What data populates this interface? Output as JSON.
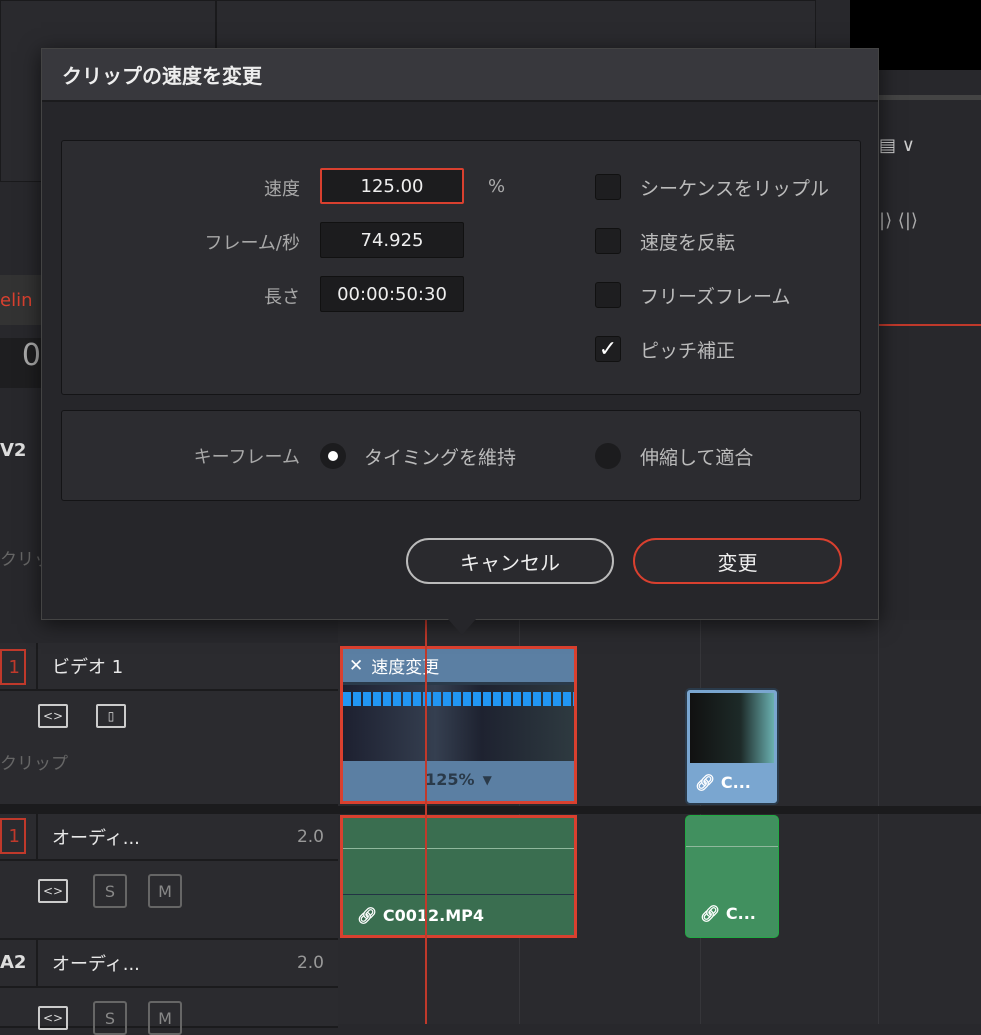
{
  "dialog": {
    "title": "クリップの速度を変更",
    "fields": [
      {
        "label": "速度",
        "value": "125.00",
        "unit": "%"
      },
      {
        "label": "フレーム/秒",
        "value": "74.925"
      },
      {
        "label": "長さ",
        "value": "00:00:50:30"
      }
    ],
    "checkboxes": [
      {
        "label": "シーケンスをリップル",
        "checked": false
      },
      {
        "label": "速度を反転",
        "checked": false
      },
      {
        "label": "フリーズフレーム",
        "checked": false
      },
      {
        "label": "ピッチ補正",
        "checked": true
      }
    ],
    "keyframe": {
      "label": "キーフレーム",
      "options": [
        {
          "label": "タイミングを維持",
          "selected": true
        },
        {
          "label": "伸縮して適合",
          "selected": false
        }
      ]
    },
    "cancel": "キャンセル",
    "change": "変更",
    "check_mark": "✓"
  },
  "background": {
    "tab_partial": "elin",
    "timecode_partial": "0",
    "v2_label": "V2",
    "clip_hint_1": "クリップ",
    "clip_hint_2": "クリップ"
  },
  "tracks": [
    {
      "num": "1",
      "name": "ビデオ 1"
    },
    {
      "num": "1",
      "name": "オーディ...",
      "channels": "2.0",
      "solo": "S",
      "mute": "M"
    },
    {
      "num": "A2",
      "name": "オーディ...",
      "channels": "2.0",
      "solo": "S",
      "mute": "M"
    }
  ],
  "clips": {
    "video_main": {
      "title": "速度変更",
      "speed": "125%"
    },
    "video_second": {
      "name": "C..."
    },
    "audio_main": {
      "name": "C0012.MP4"
    },
    "audio_second": {
      "name": "C..."
    }
  },
  "colors": {
    "accent": "#d9402f",
    "video_clip": "#5b7fa3",
    "audio_clip": "#3a6e50"
  }
}
